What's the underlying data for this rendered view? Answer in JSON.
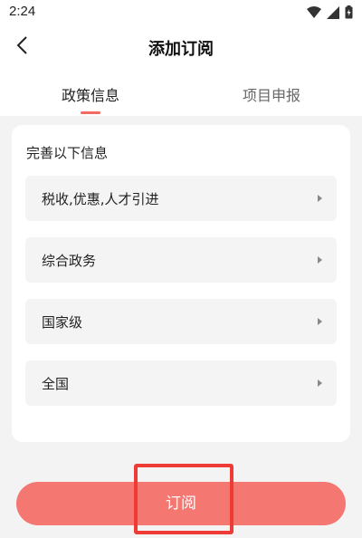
{
  "status_bar": {
    "time": "2:24",
    "icons": [
      "wifi-icon",
      "signal-icon",
      "battery-icon"
    ]
  },
  "header": {
    "title": "添加订阅",
    "back_icon": "chevron-left-icon"
  },
  "tabs": [
    {
      "label": "政策信息",
      "active": true
    },
    {
      "label": "项目申报",
      "active": false
    }
  ],
  "form": {
    "title": "完善以下信息",
    "options": [
      {
        "label": "税收,优惠,人才引进"
      },
      {
        "label": "综合政务"
      },
      {
        "label": "国家级"
      },
      {
        "label": "全国"
      }
    ]
  },
  "subscribe_button": {
    "label": "订阅"
  },
  "colors": {
    "accent": "#f26a63",
    "button": "#f57772",
    "highlight": "#ee3b36",
    "background": "#f3f3f3"
  }
}
